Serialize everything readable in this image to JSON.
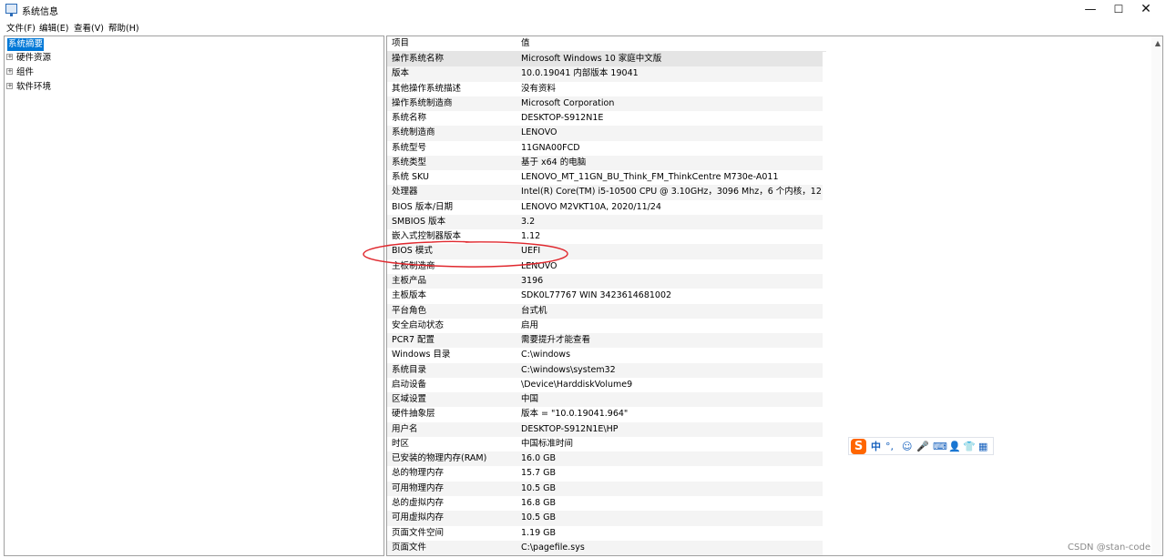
{
  "window": {
    "title": "系统信息",
    "min_glyph": "—",
    "max_glyph": "☐",
    "close_glyph": "✕"
  },
  "menu": [
    "文件(F)",
    "编辑(E)",
    "查看(V)",
    "帮助(H)"
  ],
  "tree": {
    "root": "系统摘要",
    "children": [
      "硬件资源",
      "组件",
      "软件环境"
    ],
    "expander": "+"
  },
  "table": {
    "headers": {
      "item": "项目",
      "value": "值"
    },
    "rows": [
      {
        "item": "操作系统名称",
        "value": "Microsoft Windows 10 家庭中文版"
      },
      {
        "item": "版本",
        "value": "10.0.19041 内部版本 19041"
      },
      {
        "item": "其他操作系统描述",
        "value": "没有资料"
      },
      {
        "item": "操作系统制造商",
        "value": "Microsoft Corporation"
      },
      {
        "item": "系统名称",
        "value": "DESKTOP-S912N1E"
      },
      {
        "item": "系统制造商",
        "value": "LENOVO"
      },
      {
        "item": "系统型号",
        "value": "11GNA00FCD"
      },
      {
        "item": "系统类型",
        "value": "基于 x64 的电脑"
      },
      {
        "item": "系统 SKU",
        "value": "LENOVO_MT_11GN_BU_Think_FM_ThinkCentre M730e-A011"
      },
      {
        "item": "处理器",
        "value": "Intel(R) Core(TM) i5-10500 CPU @ 3.10GHz，3096 Mhz，6 个内核，12 ..."
      },
      {
        "item": "BIOS 版本/日期",
        "value": "LENOVO M2VKT10A, 2020/11/24"
      },
      {
        "item": "SMBIOS 版本",
        "value": "3.2"
      },
      {
        "item": "嵌入式控制器版本",
        "value": "1.12"
      },
      {
        "item": "BIOS 模式",
        "value": "UEFI"
      },
      {
        "item": "主板制造商",
        "value": "LENOVO"
      },
      {
        "item": "主板产品",
        "value": "3196"
      },
      {
        "item": "主板版本",
        "value": "SDK0L77767 WIN 3423614681002"
      },
      {
        "item": "平台角色",
        "value": "台式机"
      },
      {
        "item": "安全启动状态",
        "value": "启用"
      },
      {
        "item": "PCR7 配置",
        "value": "需要提升才能查看"
      },
      {
        "item": "Windows 目录",
        "value": "C:\\windows"
      },
      {
        "item": "系统目录",
        "value": "C:\\windows\\system32"
      },
      {
        "item": "启动设备",
        "value": "\\Device\\HarddiskVolume9"
      },
      {
        "item": "区域设置",
        "value": "中国"
      },
      {
        "item": "硬件抽象层",
        "value": "版本 = \"10.0.19041.964\""
      },
      {
        "item": "用户名",
        "value": "DESKTOP-S912N1E\\HP"
      },
      {
        "item": "时区",
        "value": "中国标准时间"
      },
      {
        "item": "已安装的物理内存(RAM)",
        "value": "16.0 GB"
      },
      {
        "item": "总的物理内存",
        "value": "15.7 GB"
      },
      {
        "item": "可用物理内存",
        "value": "10.5 GB"
      },
      {
        "item": "总的虚拟内存",
        "value": "16.8 GB"
      },
      {
        "item": "可用虚拟内存",
        "value": "10.5 GB"
      },
      {
        "item": "页面文件空间",
        "value": "1.19 GB"
      },
      {
        "item": "页面文件",
        "value": "C:\\pagefile.sys"
      }
    ]
  },
  "scroll_up_glyph": "▲",
  "annotation_color": "#e0282e",
  "ime": {
    "logo": "S",
    "lang": "中",
    "icons": [
      "°,",
      "☺",
      "🎤",
      "⌨",
      "👤",
      "👕",
      "▦"
    ]
  },
  "watermark": "CSDN @stan-code"
}
